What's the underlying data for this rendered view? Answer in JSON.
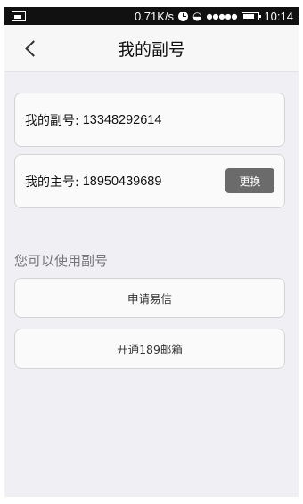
{
  "status_bar": {
    "speed": "0.71K/s",
    "time": "10:14"
  },
  "nav": {
    "title": "我的副号"
  },
  "secondary_number": {
    "label": "我的副号:",
    "value": "13348292614"
  },
  "primary_number": {
    "label": "我的主号:",
    "value": "18950439689",
    "change_label": "更换"
  },
  "section_title": "您可以使用副号",
  "actions": [
    {
      "label": "申请易信"
    },
    {
      "label": "开通189邮箱"
    }
  ]
}
